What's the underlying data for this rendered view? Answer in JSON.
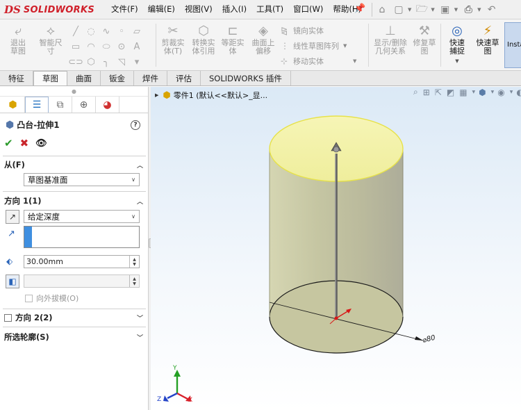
{
  "app": {
    "logo_ds": "DS",
    "logo_text": "SOLIDWORKS"
  },
  "menu": [
    "文件(F)",
    "编辑(E)",
    "视图(V)",
    "插入(I)",
    "工具(T)",
    "窗口(W)",
    "帮助(H)"
  ],
  "toolbar": {
    "exit_sketch": "退出草图",
    "smart_dim": "智能尺寸",
    "trim": "剪裁实体(T)",
    "convert": "转换实体引用",
    "offset": "等距实体",
    "offset_surface": "曲面上偏移",
    "mirror": "镜向实体",
    "linear_pattern": "线性草图阵列",
    "move": "移动实体",
    "show_relations": "显示/删除几何关系",
    "repair": "修复草图",
    "quick_snap": "快速捕捉",
    "rapid_sketch": "快速草图",
    "instant2d": "Insta"
  },
  "tabs": [
    "特征",
    "草图",
    "曲面",
    "钣金",
    "焊件",
    "评估",
    "SOLIDWORKS 插件"
  ],
  "selected_tab": "草图",
  "property_manager": {
    "feature_title": "凸台-拉伸1",
    "help": "?",
    "from": {
      "header": "从(F)",
      "value": "草图基准面"
    },
    "direction1": {
      "header": "方向 1(1)",
      "end_condition": "给定深度",
      "depth": "30.00mm",
      "draft_label": "向外拔模(O)"
    },
    "direction2": {
      "header": "方向 2(2)"
    },
    "selected_contours": {
      "header": "所选轮廓(S)"
    }
  },
  "graphics": {
    "tree_label": "零件1  (默认<<默认>_显...",
    "dimension": "⌀80",
    "axes": {
      "x": "X",
      "y": "Y",
      "z": "Z"
    }
  },
  "colors": {
    "accent": "#2a64b8",
    "top_face": "#f3f2a6",
    "body": "#c3c3a2",
    "edge": "#e7e24a",
    "tab_bar": "#e9e9e9"
  }
}
